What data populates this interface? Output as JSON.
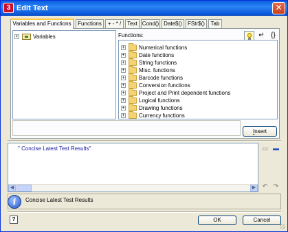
{
  "window": {
    "title": "Edit Text",
    "icon_char": "3",
    "close_char": "✕"
  },
  "tabs": [
    {
      "label": "Variables and Functions",
      "active": true
    },
    {
      "label": "Functions"
    },
    {
      "label": "+ - * /"
    },
    {
      "label": "Text"
    },
    {
      "label": "Cond()"
    },
    {
      "label": "Date$()"
    },
    {
      "label": "FStr$()"
    },
    {
      "label": "Tab"
    }
  ],
  "variables_tree": {
    "root": {
      "label": "Variables",
      "expander": "+"
    }
  },
  "functions_panel": {
    "label": "Functions:",
    "toolbar": {
      "bulb_icon": "lightbulb-icon",
      "enter_char": "↵",
      "braces_char": "{}"
    },
    "items": [
      {
        "label": "Numerical functions",
        "expander": "+"
      },
      {
        "label": "Date functions",
        "expander": "+"
      },
      {
        "label": "String functions",
        "expander": "+"
      },
      {
        "label": "Misc. functions",
        "expander": "+"
      },
      {
        "label": "Barcode functions",
        "expander": "+"
      },
      {
        "label": "Conversion functions",
        "expander": "+"
      },
      {
        "label": "Project and Print dependent functions",
        "expander": "+"
      },
      {
        "label": "Logical functions",
        "expander": "+"
      },
      {
        "label": "Drawing functions",
        "expander": "+"
      },
      {
        "label": "Currency functions",
        "expander": "+"
      }
    ]
  },
  "insert_button": {
    "label_first": "I",
    "label_rest": "nsert"
  },
  "editor": {
    "value": "\" Concise Latest Test Results\"",
    "scroll_left": "◀",
    "scroll_right": "▶"
  },
  "side_icons": {
    "top_grey": "▭",
    "top_blue": "▬",
    "undo": "↶",
    "redo": "↷"
  },
  "preview": {
    "text": "Concise Latest Test Results",
    "info_char": "i"
  },
  "footer": {
    "help_char": "?",
    "ok_label": "OK",
    "cancel_label": "Cancel"
  },
  "colors": {
    "accent": "#0a5fe0",
    "tab_highlight": "#ffc83c",
    "editor_text": "#1a1aa0"
  }
}
